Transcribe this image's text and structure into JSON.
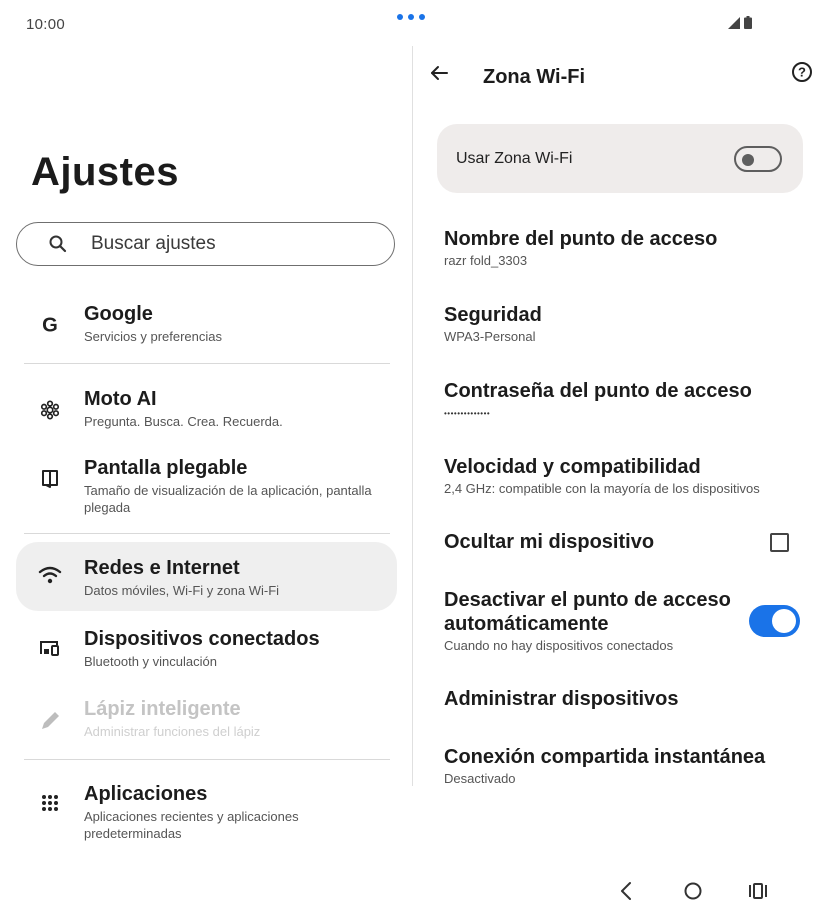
{
  "status": {
    "time": "10:00"
  },
  "left": {
    "title": "Ajustes",
    "search_placeholder": "Buscar ajustes",
    "items": [
      {
        "title": "Google",
        "subtitle": "Servicios y preferencias",
        "icon": "google-icon"
      },
      {
        "title": "Moto AI",
        "subtitle": "Pregunta. Busca. Crea. Recuerda.",
        "icon": "moto-ai-icon"
      },
      {
        "title": "Pantalla plegable",
        "subtitle": "Tamaño de visualización de la aplicación, pantalla plegada",
        "icon": "foldable-icon"
      },
      {
        "title": "Redes e Internet",
        "subtitle": "Datos móviles, Wi-Fi y zona Wi-Fi",
        "icon": "wifi-icon"
      },
      {
        "title": "Dispositivos conectados",
        "subtitle": "Bluetooth y vinculación",
        "icon": "devices-icon"
      },
      {
        "title": "Lápiz inteligente",
        "subtitle": "Administrar funciones del lápiz",
        "icon": "pen-icon"
      },
      {
        "title": "Aplicaciones",
        "subtitle": "Aplicaciones recientes y aplicaciones predeterminadas",
        "icon": "apps-icon"
      }
    ]
  },
  "right": {
    "title": "Zona Wi-Fi",
    "toggle_label": "Usar Zona Wi-Fi",
    "toggle_on": false,
    "items": [
      {
        "title": "Nombre del punto de acceso",
        "subtitle": "razr fold_3303"
      },
      {
        "title": "Seguridad",
        "subtitle": "WPA3-Personal"
      },
      {
        "title": "Contraseña del punto de acceso",
        "subtitle": "••••••••••••••"
      },
      {
        "title": "Velocidad y compatibilidad",
        "subtitle": "2,4 GHz: compatible con la mayoría de los dispositivos"
      },
      {
        "title": "Ocultar mi dispositivo",
        "checked": false
      },
      {
        "title": "Desactivar el punto de acceso automáticamente",
        "subtitle": "Cuando no hay dispositivos conectados",
        "toggle_on": true
      },
      {
        "title": "Administrar dispositivos"
      },
      {
        "title": "Conexión compartida instantánea",
        "subtitle": "Desactivado"
      }
    ]
  },
  "colors": {
    "accent": "#1a73e8",
    "selected_bg": "#efefef",
    "card_bg": "#efeceb"
  }
}
